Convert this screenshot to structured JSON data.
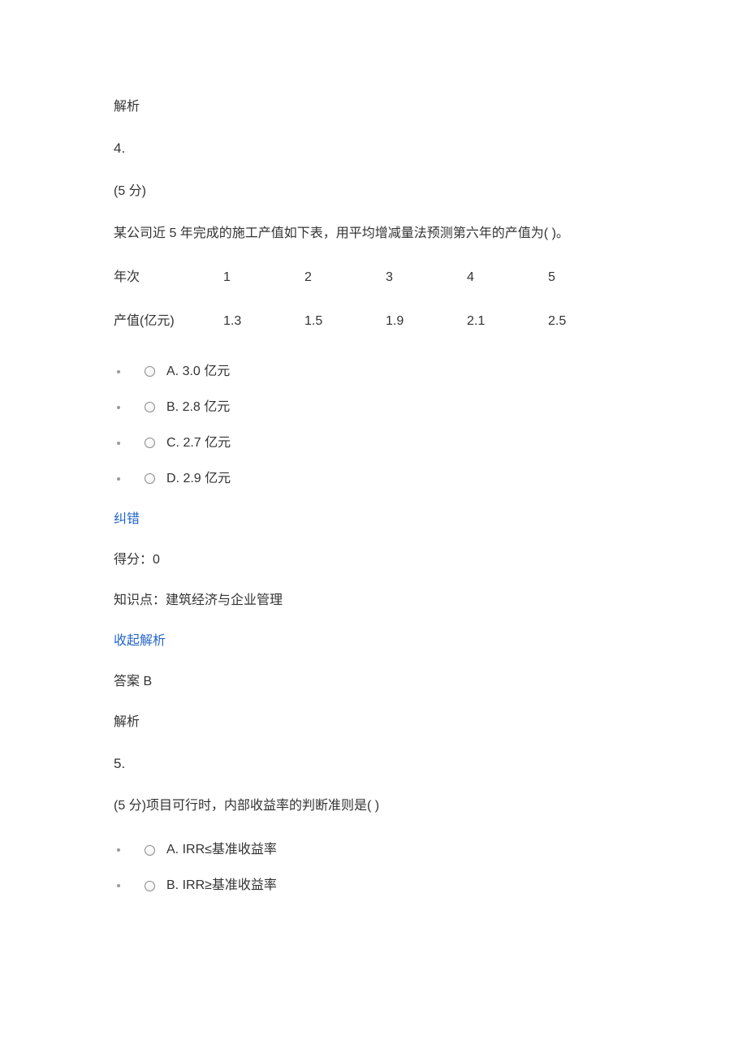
{
  "q3_tail": {
    "analysis_label": "解析"
  },
  "q4": {
    "number": "4.",
    "score_label": "(5 分)",
    "stem": "某公司近 5 年完成的施工产值如下表，用平均增减量法预测第六年的产值为( )。",
    "table": {
      "header_label": "年次",
      "header_cols": [
        "1",
        "2",
        "3",
        "4",
        "5"
      ],
      "value_label": "产值(亿元)",
      "value_cols": [
        "1.3",
        "1.5",
        "1.9",
        "2.1",
        "2.5"
      ]
    },
    "options": [
      {
        "label": "A. 3.0 亿元"
      },
      {
        "label": "B. 2.8 亿元"
      },
      {
        "label": "C. 2.7 亿元"
      },
      {
        "label": "D. 2.9 亿元"
      }
    ],
    "correction_link": "纠错",
    "score_result": "得分：0",
    "knowledge_point": "知识点：建筑经济与企业管理",
    "collapse_link": "收起解析",
    "answer": "答案 B",
    "analysis_label": "解析"
  },
  "q5": {
    "number": "5.",
    "score_stem": "(5 分)项目可行时，内部收益率的判断准则是(    )",
    "options": [
      {
        "label": "A. IRR≤基准收益率"
      },
      {
        "label": "B. IRR≥基准收益率"
      }
    ]
  }
}
